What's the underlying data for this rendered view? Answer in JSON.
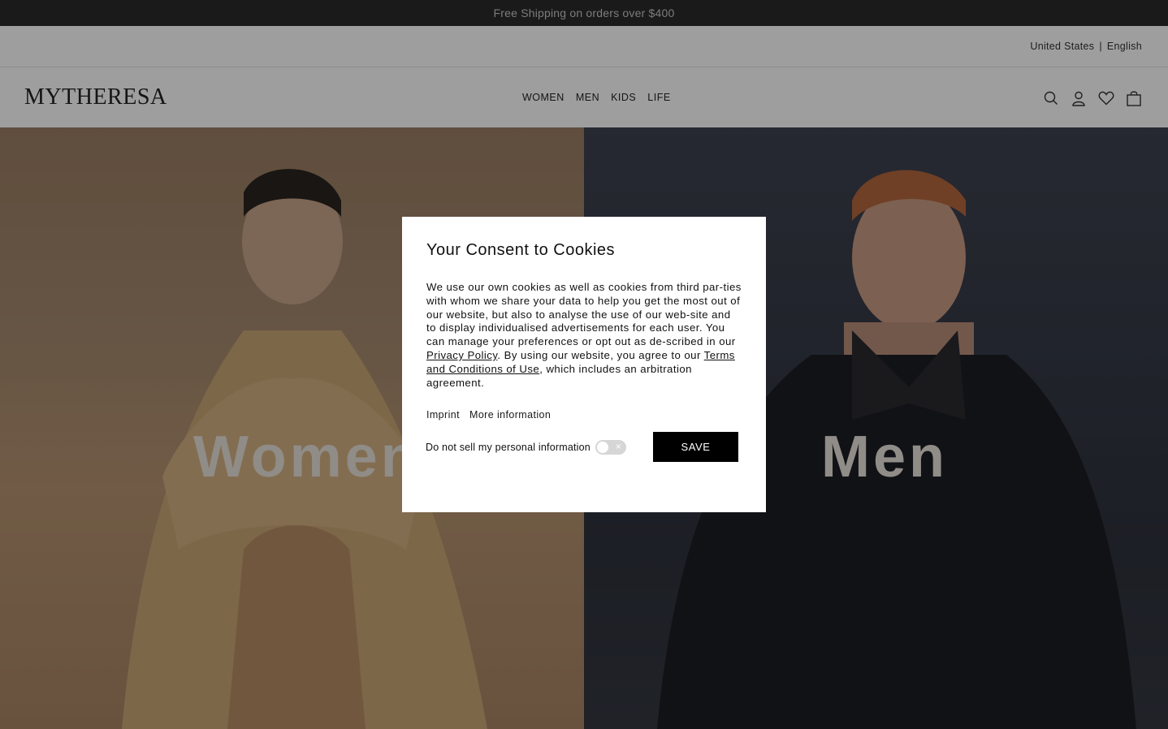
{
  "promo": {
    "text": "Free Shipping on orders over $400"
  },
  "locale": {
    "country": "United States",
    "separator": "|",
    "language": "English"
  },
  "header": {
    "logo": "MYTHERESA",
    "nav": [
      "WOMEN",
      "MEN",
      "KIDS",
      "LIFE"
    ],
    "icons": [
      "search-icon",
      "account-icon",
      "wishlist-icon",
      "bag-icon"
    ]
  },
  "hero": {
    "women_title": "Women",
    "men_title": "Men"
  },
  "consent": {
    "title": "Your Consent to Cookies",
    "body_1": "We use our own cookies as well as cookies from third par-ties with whom we share your data to help you get the most out of our website, but also to analyse the use of our web-site and to display individualised advertisements for each user. You can manage your preferences or opt out as de-scribed in our ",
    "privacy_link": "Privacy Policy",
    "body_2": ". By using our website, you agree to our ",
    "terms_link": "Terms and Conditions of Use",
    "body_3": ", which includes an arbitration agreement.",
    "imprint_link": "Imprint",
    "more_info_link": "More information",
    "dns_label": "Do not sell my personal information",
    "toggle_symbol": "×",
    "save_label": "SAVE"
  },
  "colors": {
    "promo_bg": "#2a2a2a",
    "save_bg": "#000000",
    "toggle_off": "#d6d6d6"
  }
}
